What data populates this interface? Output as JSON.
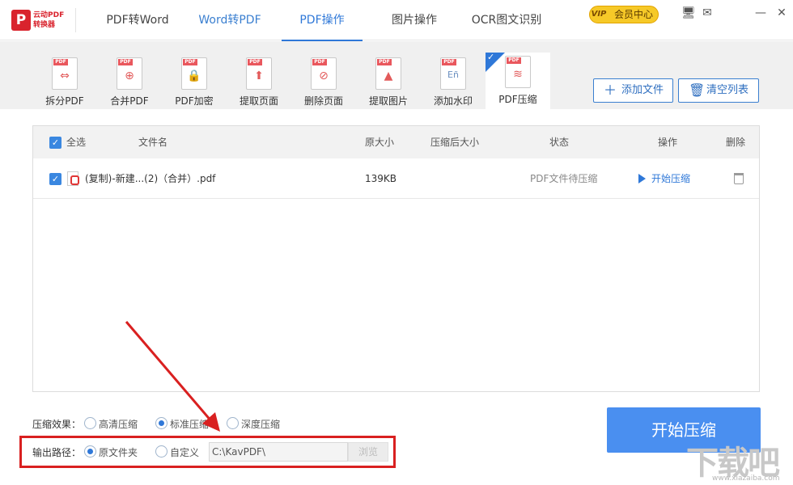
{
  "app": {
    "logo_letter": "P",
    "logo_line1": "云动PDF",
    "logo_line2": "转换器"
  },
  "nav_tabs": [
    {
      "label": "PDF转Word"
    },
    {
      "label": "Word转PDF"
    },
    {
      "label": "PDF操作"
    },
    {
      "label": "图片操作"
    },
    {
      "label": "OCR图文识别"
    }
  ],
  "vip": {
    "mark": "VIP",
    "label": "会员中心"
  },
  "tools": [
    {
      "label": "拆分PDF",
      "tag": "PDF",
      "glyph": "⇔"
    },
    {
      "label": "合并PDF",
      "tag": "PDF",
      "glyph": "⊕"
    },
    {
      "label": "PDF加密",
      "tag": "PDF",
      "glyph": "🔒"
    },
    {
      "label": "提取页面",
      "tag": "PDF",
      "glyph": "⬆"
    },
    {
      "label": "删除页面",
      "tag": "PDF",
      "glyph": "⊘"
    },
    {
      "label": "提取图片",
      "tag": "PDF",
      "glyph": "▲"
    },
    {
      "label": "添加水印",
      "tag": "PDF",
      "glyph": "Eñ"
    },
    {
      "label": "PDF压缩",
      "tag": "PDF",
      "glyph": "≋"
    }
  ],
  "actions": {
    "add_file": "添加文件",
    "clear_list": "清空列表"
  },
  "table": {
    "headers": {
      "select_all": "全选",
      "file_name": "文件名",
      "original_size": "原大小",
      "compressed_size": "压缩后大小",
      "status": "状态",
      "operation": "操作",
      "delete": "删除"
    },
    "rows": [
      {
        "name": "(复制)-新建...(2)（合并）.pdf",
        "original_size": "139KB",
        "compressed_size": "",
        "status": "PDF文件待压缩",
        "action": "开始压缩"
      }
    ]
  },
  "compression": {
    "label": "压缩效果：",
    "options": [
      "高清压缩",
      "标准压缩",
      "深度压缩"
    ],
    "selected": "标准压缩"
  },
  "output": {
    "label": "输出路径：",
    "options": [
      "原文件夹",
      "自定义"
    ],
    "selected": "原文件夹",
    "path": "C:\\KavPDF\\",
    "browse": "浏览"
  },
  "start_button": "开始压缩",
  "watermark": {
    "main": "下载吧",
    "sub": "www.xiazaiba.com"
  },
  "colors": {
    "accent": "#2f78d8",
    "start_button": "#4a8ff0",
    "highlight": "#d92020",
    "pdf_red": "#e9575d"
  }
}
